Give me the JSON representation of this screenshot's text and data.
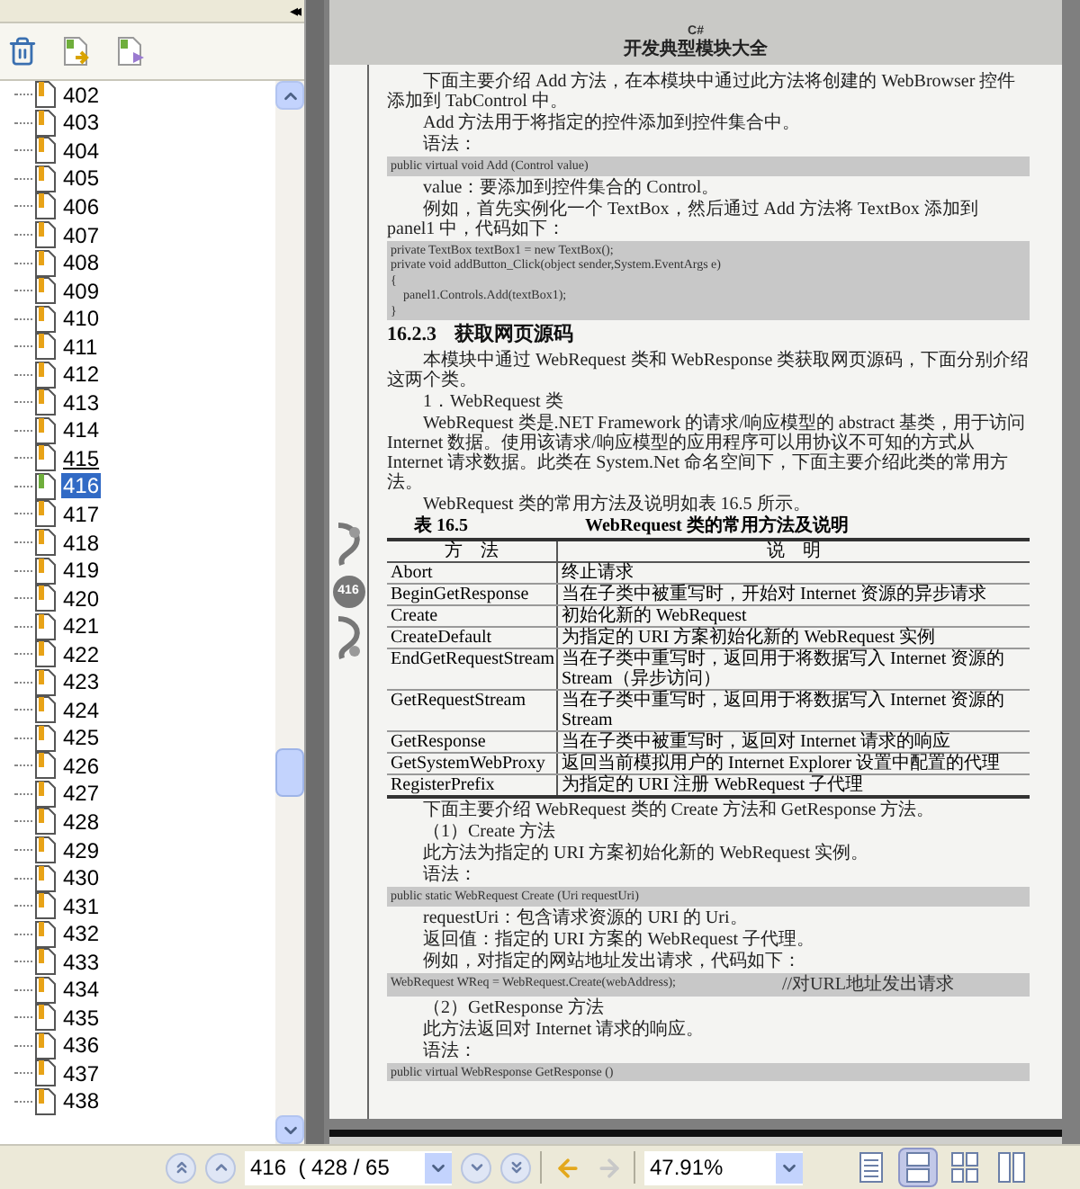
{
  "sidebar": {
    "collapse_label": "◂◂",
    "bookmarks": [
      {
        "label": "402",
        "selected": false,
        "hovered": false
      },
      {
        "label": "403",
        "selected": false,
        "hovered": false
      },
      {
        "label": "404",
        "selected": false,
        "hovered": false
      },
      {
        "label": "405",
        "selected": false,
        "hovered": false
      },
      {
        "label": "406",
        "selected": false,
        "hovered": false
      },
      {
        "label": "407",
        "selected": false,
        "hovered": false
      },
      {
        "label": "408",
        "selected": false,
        "hovered": false
      },
      {
        "label": "409",
        "selected": false,
        "hovered": false
      },
      {
        "label": "410",
        "selected": false,
        "hovered": false
      },
      {
        "label": "411",
        "selected": false,
        "hovered": false
      },
      {
        "label": "412",
        "selected": false,
        "hovered": false
      },
      {
        "label": "413",
        "selected": false,
        "hovered": false
      },
      {
        "label": "414",
        "selected": false,
        "hovered": false
      },
      {
        "label": "415",
        "selected": false,
        "hovered": true
      },
      {
        "label": "416",
        "selected": true,
        "hovered": false
      },
      {
        "label": "417",
        "selected": false,
        "hovered": false
      },
      {
        "label": "418",
        "selected": false,
        "hovered": false
      },
      {
        "label": "419",
        "selected": false,
        "hovered": false
      },
      {
        "label": "420",
        "selected": false,
        "hovered": false
      },
      {
        "label": "421",
        "selected": false,
        "hovered": false
      },
      {
        "label": "422",
        "selected": false,
        "hovered": false
      },
      {
        "label": "423",
        "selected": false,
        "hovered": false
      },
      {
        "label": "424",
        "selected": false,
        "hovered": false
      },
      {
        "label": "425",
        "selected": false,
        "hovered": false
      },
      {
        "label": "426",
        "selected": false,
        "hovered": false
      },
      {
        "label": "427",
        "selected": false,
        "hovered": false
      },
      {
        "label": "428",
        "selected": false,
        "hovered": false
      },
      {
        "label": "429",
        "selected": false,
        "hovered": false
      },
      {
        "label": "430",
        "selected": false,
        "hovered": false
      },
      {
        "label": "431",
        "selected": false,
        "hovered": false
      },
      {
        "label": "432",
        "selected": false,
        "hovered": false
      },
      {
        "label": "433",
        "selected": false,
        "hovered": false
      },
      {
        "label": "434",
        "selected": false,
        "hovered": false
      },
      {
        "label": "435",
        "selected": false,
        "hovered": false
      },
      {
        "label": "436",
        "selected": false,
        "hovered": false
      },
      {
        "label": "437",
        "selected": false,
        "hovered": false
      },
      {
        "label": "438",
        "selected": false,
        "hovered": false
      }
    ]
  },
  "page": {
    "header_logo": "C#",
    "header_title": "开发典型模块大全",
    "page_number": "416",
    "blocks": [
      {
        "kind": "para",
        "text": "下面主要介绍 Add 方法，在本模块中通过此方法将创建的 WebBrowser 控件添加到 TabControl 中。"
      },
      {
        "kind": "para",
        "text": "Add 方法用于将指定的控件添加到控件集合中。"
      },
      {
        "kind": "para",
        "text": "语法："
      },
      {
        "kind": "code",
        "lines": [
          {
            "code": "public virtual void Add (Control value)"
          }
        ]
      },
      {
        "kind": "para",
        "text": "value：要添加到控件集合的 Control。"
      },
      {
        "kind": "para",
        "text": "例如，首先实例化一个 TextBox，然后通过 Add 方法将 TextBox 添加到 panel1 中，代码如下："
      },
      {
        "kind": "code",
        "lines": [
          {
            "code": "private TextBox textBox1 = new TextBox();"
          },
          {
            "code": "private void addButton_Click(object sender,System.EventArgs e)"
          },
          {
            "code": "{"
          },
          {
            "code": "    panel1.Controls.Add(textBox1);"
          },
          {
            "code": "}"
          }
        ]
      },
      {
        "kind": "heading",
        "number": "16.2.3",
        "text": "获取网页源码"
      },
      {
        "kind": "para",
        "text": "本模块中通过 WebRequest 类和 WebResponse 类获取网页源码，下面分别介绍这两个类。"
      },
      {
        "kind": "para",
        "text": "1．WebRequest 类"
      },
      {
        "kind": "para",
        "text": "WebRequest 类是.NET Framework 的请求/响应模型的 abstract 基类，用于访问 Internet 数据。使用该请求/响应模型的应用程序可以用协议不可知的方式从 Internet 请求数据。此类在 System.Net 命名空间下，下面主要介绍此类的常用方法。"
      },
      {
        "kind": "para",
        "text": "WebRequest 类的常用方法及说明如表 16.5 所示。"
      },
      {
        "kind": "table",
        "number": "表 16.5",
        "caption": "WebRequest 类的常用方法及说明",
        "columns": [
          "方　法",
          "说　明"
        ],
        "rows": [
          [
            "Abort",
            "终止请求"
          ],
          [
            "BeginGetResponse",
            "当在子类中被重写时，开始对 Internet 资源的异步请求"
          ],
          [
            "Create",
            "初始化新的 WebRequest"
          ],
          [
            "CreateDefault",
            "为指定的 URI 方案初始化新的 WebRequest 实例"
          ],
          [
            "EndGetRequestStream",
            "当在子类中重写时，返回用于将数据写入 Internet 资源的 Stream（异步访问）"
          ],
          [
            "GetRequestStream",
            "当在子类中重写时，返回用于将数据写入 Internet 资源的 Stream"
          ],
          [
            "GetResponse",
            "当在子类中被重写时，返回对 Internet 请求的响应"
          ],
          [
            "GetSystemWebProxy",
            "返回当前模拟用户的 Internet Explorer 设置中配置的代理"
          ],
          [
            "RegisterPrefix",
            "为指定的 URI 注册 WebRequest 子代理"
          ]
        ]
      },
      {
        "kind": "para",
        "text": "下面主要介绍 WebRequest 类的 Create 方法和 GetResponse 方法。"
      },
      {
        "kind": "para",
        "text": "（1）Create 方法"
      },
      {
        "kind": "para",
        "text": "此方法为指定的 URI 方案初始化新的 WebRequest 实例。"
      },
      {
        "kind": "para",
        "text": "语法："
      },
      {
        "kind": "code",
        "lines": [
          {
            "code": "public static WebRequest Create (Uri requestUri)"
          }
        ]
      },
      {
        "kind": "para",
        "text": "requestUri：包含请求资源的 URI 的 Uri。"
      },
      {
        "kind": "para",
        "text": "返回值：指定的 URI 方案的 WebRequest 子代理。"
      },
      {
        "kind": "para",
        "text": "例如，对指定的网站地址发出请求，代码如下："
      },
      {
        "kind": "code",
        "lines": [
          {
            "code": "WebRequest WReq = WebRequest.Create(webAddress);",
            "comment": "//对URL地址发出请求"
          }
        ]
      },
      {
        "kind": "para",
        "text": "（2）GetResponse 方法"
      },
      {
        "kind": "para",
        "text": "此方法返回对 Internet 请求的响应。"
      },
      {
        "kind": "para",
        "text": "语法："
      },
      {
        "kind": "code",
        "lines": [
          {
            "code": "public virtual WebResponse GetResponse ()"
          }
        ]
      }
    ]
  },
  "toolbar": {
    "page_field": "416  ( 428 / 65",
    "zoom_field": "47.91%",
    "history": [
      {
        "kind": "back",
        "disabled": false
      },
      {
        "kind": "forward",
        "disabled": true
      }
    ],
    "view_modes": [
      {
        "kind": "single",
        "selected": false
      },
      {
        "kind": "continuous",
        "selected": true
      },
      {
        "kind": "grid",
        "selected": false
      },
      {
        "kind": "facing",
        "selected": false
      }
    ]
  }
}
